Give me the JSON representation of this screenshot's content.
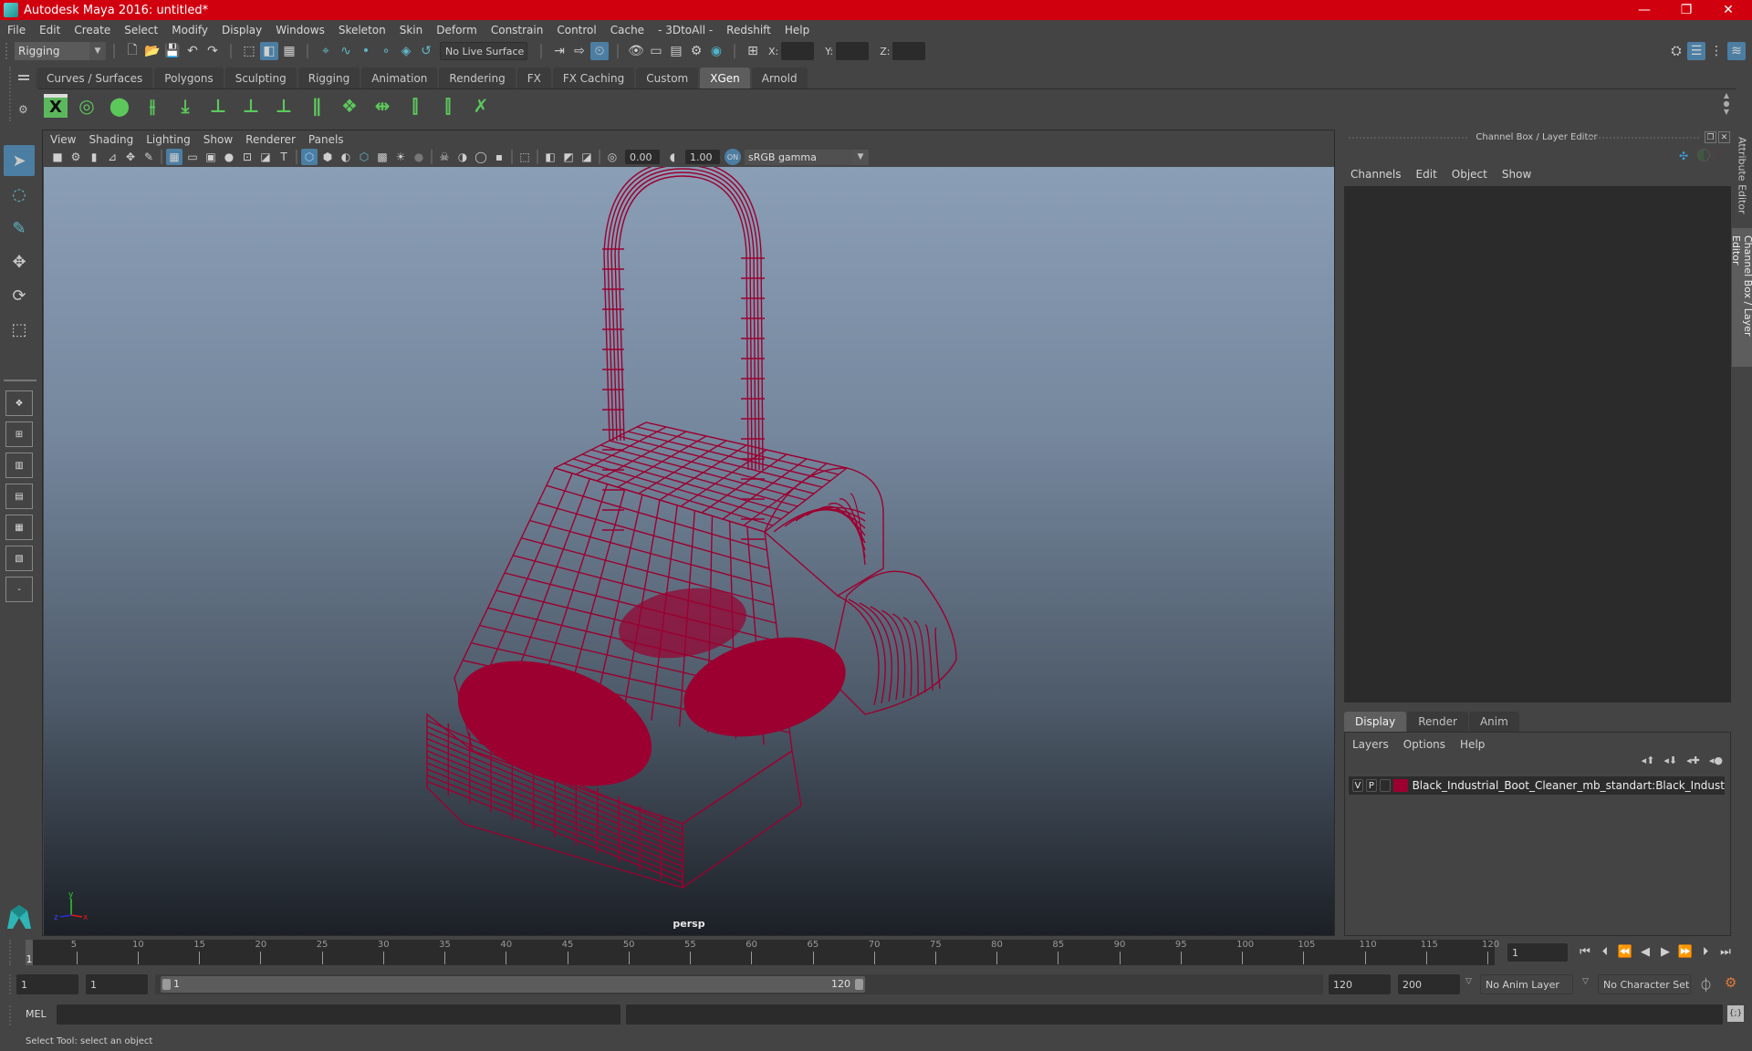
{
  "window": {
    "title": "Autodesk Maya 2016: untitled*",
    "controls": {
      "minimize": "—",
      "restore": "❐",
      "close": "✕"
    }
  },
  "menubar": [
    "File",
    "Edit",
    "Create",
    "Select",
    "Modify",
    "Display",
    "Windows",
    "Skeleton",
    "Skin",
    "Deform",
    "Constrain",
    "Control",
    "Cache",
    "- 3DtoAll -",
    "Redshift",
    "Help"
  ],
  "statusline": {
    "menuset": "Rigging",
    "live_surface": "No Live Surface",
    "x_label": "X:",
    "y_label": "Y:",
    "z_label": "Z:",
    "x_value": "",
    "y_value": "",
    "z_value": ""
  },
  "shelf": {
    "tabs": [
      "Curves / Surfaces",
      "Polygons",
      "Sculpting",
      "Rigging",
      "Animation",
      "Rendering",
      "FX",
      "FX Caching",
      "Custom",
      "XGen",
      "Arnold"
    ],
    "active_tab": "XGen",
    "icons": [
      "xgen-editor-icon",
      "xgen-preview-icon",
      "xgen-clear-icon",
      "add-guides-icon",
      "sculpt-guides-icon",
      "add-guide-icon",
      "guide-visibility-icon",
      "lock-guide-icon",
      "rebuild-guides-icon",
      "groom-icon",
      "bend-guides-icon",
      "select-guides-icon",
      "guide-cv-icon",
      "delete-guides-icon"
    ]
  },
  "viewport": {
    "menu": [
      "View",
      "Shading",
      "Lighting",
      "Show",
      "Renderer",
      "Panels"
    ],
    "exposure": "0.00",
    "gamma": "1.00",
    "color_space": "sRGB gamma",
    "camera_label": "persp",
    "axis": {
      "x": "x",
      "y": "y",
      "z": "z"
    },
    "wire_color": "#9b0030"
  },
  "channelbox": {
    "header": "Channel Box / Layer Editor",
    "menu": [
      "Channels",
      "Edit",
      "Object",
      "Show"
    ]
  },
  "layereditor": {
    "tabs": [
      "Display",
      "Render",
      "Anim"
    ],
    "active_tab": "Display",
    "menu": [
      "Layers",
      "Options",
      "Help"
    ],
    "layers": [
      {
        "visible": "V",
        "playback": "P",
        "color": "#9b0030",
        "name": "Black_Industrial_Boot_Cleaner_mb_standart:Black_Indust"
      }
    ]
  },
  "sidetabs": [
    "Attribute Editor",
    "Channel Box / Layer Editor"
  ],
  "timeslider": {
    "ticks": [
      5,
      10,
      15,
      20,
      25,
      30,
      35,
      40,
      45,
      50,
      55,
      60,
      65,
      70,
      75,
      80,
      85,
      90,
      95,
      100,
      105,
      110,
      115,
      120
    ],
    "current_frame_marker": "1",
    "current_frame": "1",
    "range_min": 1,
    "range_max": 120
  },
  "rangeslider": {
    "start_time": "1",
    "playback_start": "1",
    "range_start_label": "1",
    "range_end_label": "120",
    "playback_end": "120",
    "end_time": "200",
    "anim_layer": "No Anim Layer",
    "character_set": "No Character Set"
  },
  "commandline": {
    "language": "MEL",
    "input": "",
    "result": ""
  },
  "helpline": "Select Tool: select an object"
}
